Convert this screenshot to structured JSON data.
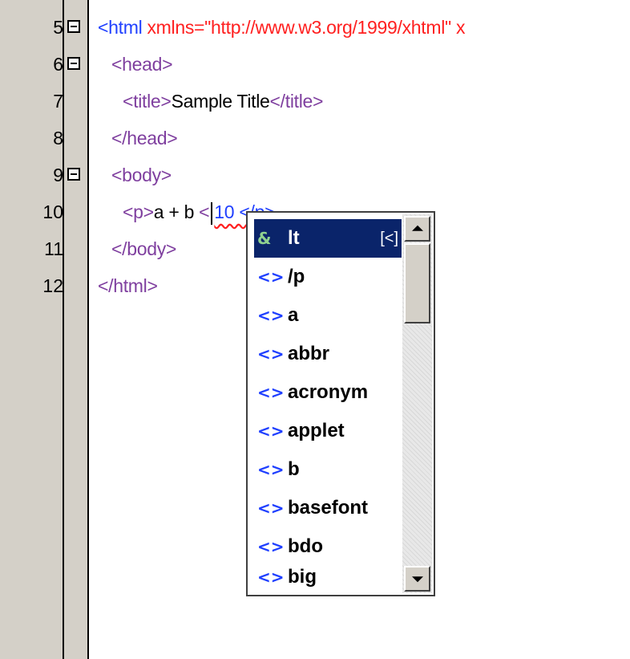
{
  "editor": {
    "line_numbers": [
      "5",
      "6",
      "7",
      "8",
      "9",
      "10",
      "11",
      "12"
    ],
    "lines": {
      "l5": {
        "open": "<html ",
        "attr": "xmlns=\"http://www.w3.org/1999/xhtml\" x"
      },
      "l6": {
        "tag": "<head>"
      },
      "l7": {
        "open": "<title>",
        "text": "Sample Title",
        "close": "</title>"
      },
      "l8": {
        "tag": "</head>"
      },
      "l9": {
        "tag": "<body>"
      },
      "l10": {
        "open": "<p>",
        "text": "a + b ",
        "lt": "<",
        "error_text": "10 </p>"
      },
      "l11": {
        "tag": "</body>"
      },
      "l12": {
        "tag": "</html>"
      }
    }
  },
  "completion": {
    "items": [
      {
        "icon": "&",
        "label": "lt",
        "shortcut": "[<]",
        "selected": true
      },
      {
        "icon": "<>",
        "label": "/p"
      },
      {
        "icon": "<>",
        "label": "a"
      },
      {
        "icon": "<>",
        "label": "abbr"
      },
      {
        "icon": "<>",
        "label": "acronym"
      },
      {
        "icon": "<>",
        "label": "applet"
      },
      {
        "icon": "<>",
        "label": "b"
      },
      {
        "icon": "<>",
        "label": "basefont"
      },
      {
        "icon": "<>",
        "label": "bdo"
      },
      {
        "icon": "<>",
        "label": "big"
      }
    ]
  },
  "colors": {
    "gutter_bg": "#d4d0c8",
    "selection_bg": "#0a246a",
    "tag": "#7f3f9f",
    "attribute": "#ff2020",
    "tag_blue": "#2040ff"
  }
}
